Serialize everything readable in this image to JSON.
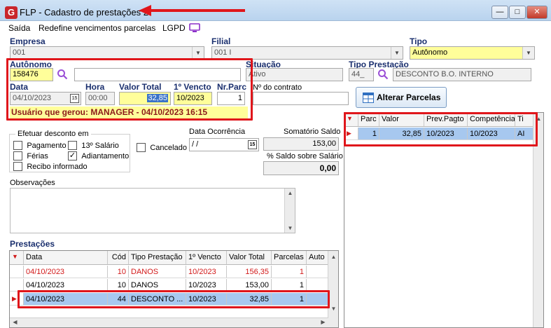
{
  "window": {
    "title": "FLP - Cadastro de prestações 2",
    "min_glyph": "—",
    "max_glyph": "□",
    "close_glyph": "✕"
  },
  "menu": {
    "sair": "Saída",
    "redefine": "Redefine vencimentos parcelas",
    "lgpd": "LGPD"
  },
  "form": {
    "empresa": {
      "label": "Empresa",
      "value": "001"
    },
    "filial": {
      "label": "Filial",
      "value": "001 I"
    },
    "tipo": {
      "label": "Tipo",
      "value": "Autônomo"
    },
    "autonomo": {
      "label": "Autônomo",
      "code": "158476",
      "name": ""
    },
    "situacao": {
      "label": "Situação",
      "value": "Ativo"
    },
    "tipo_prestacao": {
      "label": "Tipo Prestação",
      "code": "44_",
      "desc": "DESCONTO B.O. INTERNO"
    },
    "data": {
      "label": "Data",
      "value": "04/10/2023",
      "cal": "15"
    },
    "hora": {
      "label": "Hora",
      "value": "00:00"
    },
    "valor_total": {
      "label": "Valor Total",
      "value": "32,85"
    },
    "primeiro_vencto": {
      "label": "1º Vencto",
      "value": "10/2023"
    },
    "nr_parc": {
      "label": "Nr.Parc",
      "value": "1"
    },
    "nr_contrato": {
      "label": "Nº do contrato",
      "value": ""
    },
    "usuario_gerou": "Usuário que gerou: MANAGER - 04/10/2023 16:15",
    "alterar_parcelas": "Alterar Parcelas",
    "efetuar_desconto": {
      "title": "Efetuar desconto em",
      "pagamento": "Pagamento",
      "decimo_terceiro": "13º Salário",
      "ferias": "Férias",
      "adiantamento": "Adiantamento",
      "recibo": "Recibo informado",
      "check": "✓"
    },
    "cancelado": "Cancelado",
    "data_ocorrencia": {
      "label": "Data Ocorrência",
      "value": " / /",
      "cal": "15"
    },
    "somatorio_saldo": {
      "label": "Somatório Saldo",
      "value": "153,00"
    },
    "saldo_salario": {
      "label": "% Saldo sobre Salário",
      "value": "0,00"
    },
    "observacoes": {
      "label": "Observações",
      "value": ""
    }
  },
  "prestacoes": {
    "title": "Prestações",
    "indicator_head": "▼",
    "indicator_row": "▶",
    "columns": [
      "Data",
      "Cód",
      "Tipo Prestação",
      "1º Vencto",
      "Valor Total",
      "Parcelas",
      "Auto"
    ],
    "rows": [
      {
        "data": "04/10/2023",
        "cod": "10",
        "tipo": "DANOS",
        "vencto": "10/2023",
        "valor": "156,35",
        "parcelas": "1",
        "red": true
      },
      {
        "data": "04/10/2023",
        "cod": "10",
        "tipo": "DANOS",
        "vencto": "10/2023",
        "valor": "153,00",
        "parcelas": "1",
        "red": false
      },
      {
        "data": "04/10/2023",
        "cod": "44",
        "tipo": "DESCONTO ...",
        "vencto": "10/2023",
        "valor": "32,85",
        "parcelas": "1",
        "red": false
      }
    ]
  },
  "parcelas": {
    "indicator_head": "▼",
    "indicator_row": "▶",
    "columns": [
      "Parc",
      "Valor",
      "Prev.Pagto",
      "Competência",
      "Ti"
    ],
    "rows": [
      {
        "parc": "1",
        "valor": "32,85",
        "prev": "10/2023",
        "comp": "10/2023",
        "ti": "AI"
      }
    ]
  },
  "scroll": {
    "up": "▲",
    "down": "▼",
    "left": "◀",
    "right": "▶"
  },
  "colors": {
    "highlight_red": "#e0161b",
    "row_selected": "#a7c8ef",
    "field_yellow": "#fffe9a",
    "label_blue": "#1a2f6e"
  }
}
